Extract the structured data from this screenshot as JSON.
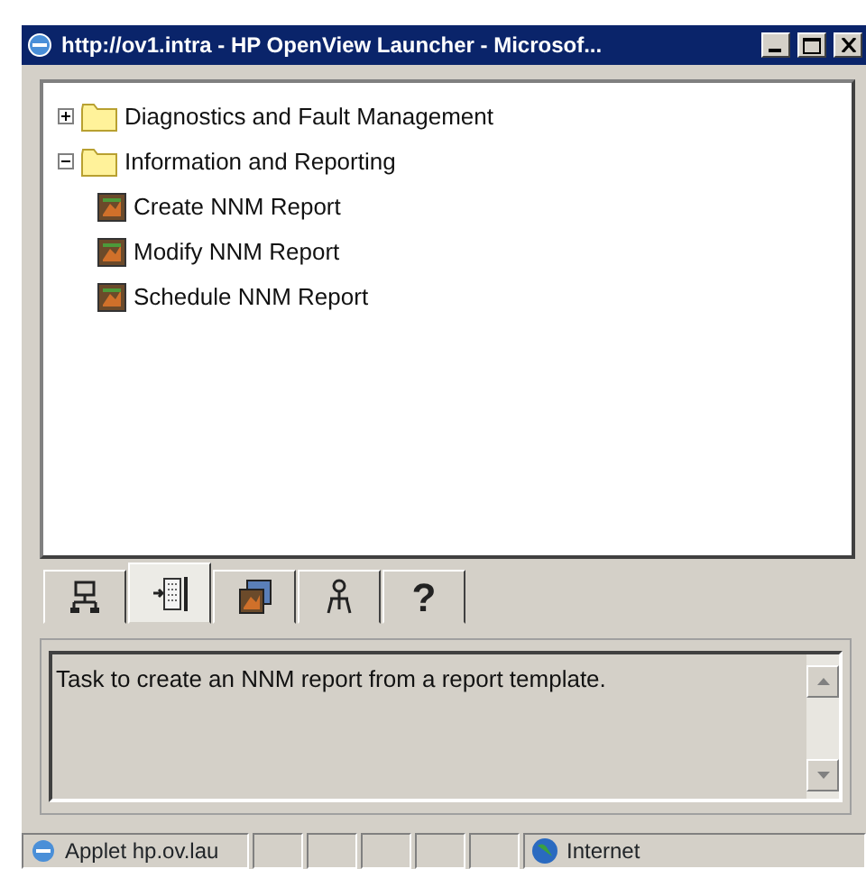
{
  "window": {
    "title": "http://ov1.intra - HP OpenView Launcher - Microsof..."
  },
  "tree": [
    {
      "label": "Diagnostics and Fault Management",
      "expanded": false
    },
    {
      "label": "Information and Reporting",
      "expanded": true,
      "children": [
        {
          "label": "Create NNM Report"
        },
        {
          "label": "Modify NNM Report"
        },
        {
          "label": "Schedule NNM Report"
        }
      ]
    }
  ],
  "tabs": [
    {
      "selected": false
    },
    {
      "selected": true
    },
    {
      "selected": false
    },
    {
      "selected": false
    },
    {
      "label": "?",
      "selected": false
    }
  ],
  "description": "Task to create an NNM report from a report template.",
  "status_bar": {
    "applet": "Applet hp.ov.lau",
    "zone": "Internet"
  }
}
